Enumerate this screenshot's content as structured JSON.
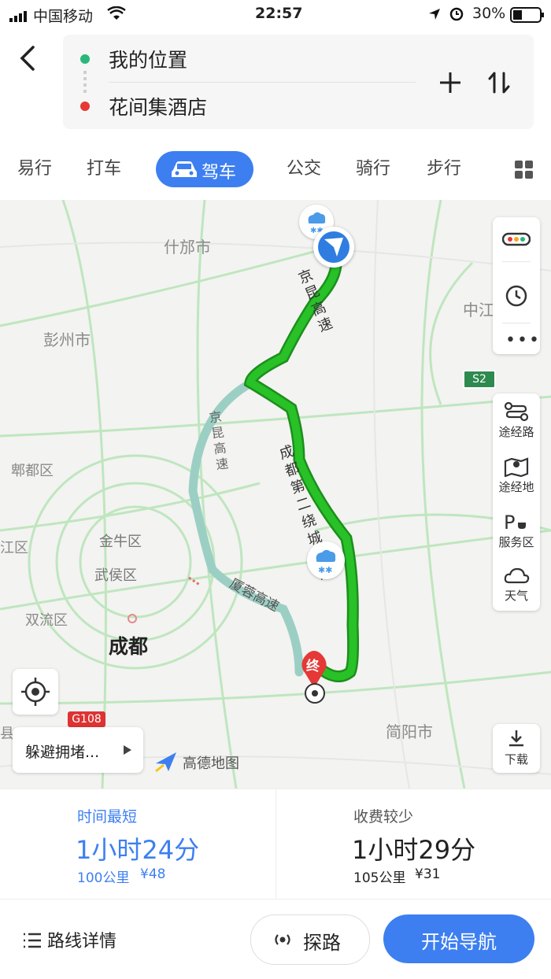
{
  "status_bar": {
    "carrier": "中国移动",
    "time": "22:57",
    "battery": "30%"
  },
  "route": {
    "origin": "我的位置",
    "destination": "花间集酒店"
  },
  "tabs": [
    "易行",
    "打车",
    "驾车",
    "公交",
    "骑行",
    "步行"
  ],
  "active_tab": "驾车",
  "map": {
    "place_labels": [
      "什邡市",
      "彭州市",
      "郫都区",
      "金牛区",
      "武侯区",
      "江区",
      "双流区",
      "成都",
      "中江",
      "简阳市",
      "县"
    ],
    "road_labels": [
      "京昆高速",
      "京昆高速",
      "成都第二绕城高速",
      "厦蓉高速"
    ],
    "shields": [
      "S2",
      "G108"
    ],
    "end_marker": "终",
    "brand": "高德地图"
  },
  "side_controls": {
    "waypoint_route": "途经路",
    "waypoint_place": "途经地",
    "service_area": "服务区",
    "weather": "天气",
    "download": "下载"
  },
  "avoid_congestion": "躲避拥堵...",
  "route_options": [
    {
      "title": "时间最短",
      "time": "1小时24分",
      "distance": "100公里",
      "toll": "¥48",
      "selected": true
    },
    {
      "title": "收费较少",
      "time": "1小时29分",
      "distance": "105公里",
      "toll": "¥31",
      "selected": false
    }
  ],
  "bottom": {
    "details": "路线详情",
    "explore": "探路",
    "start": "开始导航"
  },
  "colors": {
    "accent": "#3d7ff0",
    "route_green": "#1fb31f",
    "origin_dot": "#2ab87a",
    "dest_dot": "#e53935"
  }
}
